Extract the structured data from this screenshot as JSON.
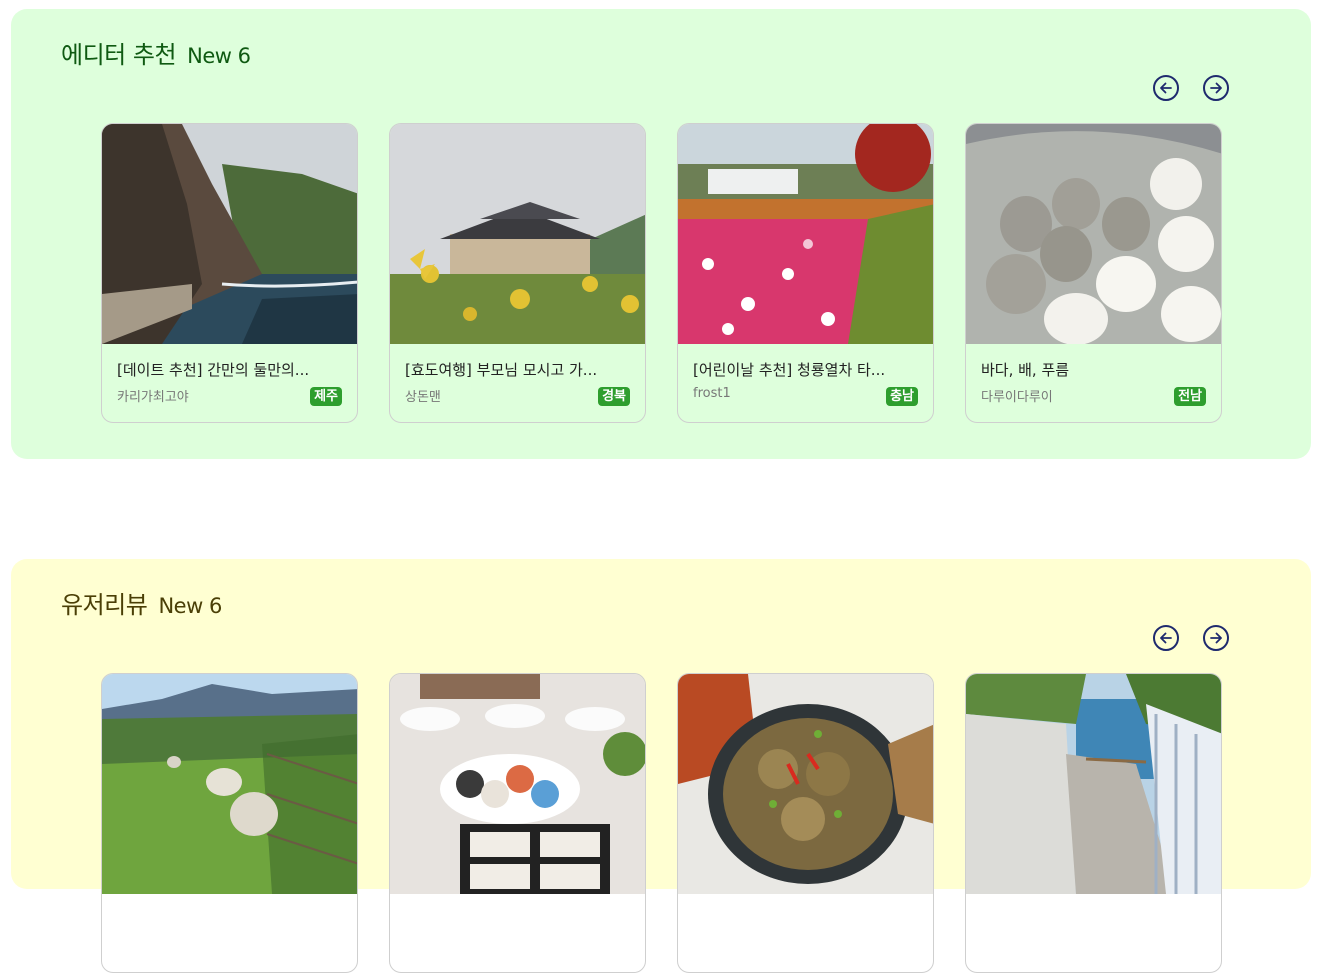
{
  "colors": {
    "editor_bg": "#deffdc",
    "editor_title": "#0f5a12",
    "user_bg": "#ffffd2",
    "user_title": "#4a3f06",
    "arrow": "#1f2a6e",
    "badge": "#2e9e2e"
  },
  "editor_section": {
    "title": "에디터 추천",
    "new_label": "New 6",
    "prev_icon": "arrow-left-circle-icon",
    "next_icon": "arrow-right-circle-icon",
    "cards": [
      {
        "title": "[데이트 추천] 간만의 둘만의...",
        "author": "카리가최고야",
        "region": "제주",
        "image": "coastal-cliff-photo"
      },
      {
        "title": "[효도여행] 부모님 모시고 가...",
        "author": "상돈맨",
        "region": "경북",
        "image": "hanok-sunflower-photo"
      },
      {
        "title": "[어린이날 추천] 청룡열차 타...",
        "author": "frost1",
        "region": "충남",
        "image": "tulip-garden-photo"
      },
      {
        "title": "바다, 배, 푸름",
        "author": "다루이다루이",
        "region": "전남",
        "image": "steamed-buns-photo"
      }
    ]
  },
  "user_section": {
    "title": "유저리뷰",
    "new_label": "New 6",
    "prev_icon": "arrow-left-circle-icon",
    "next_icon": "arrow-right-circle-icon",
    "cards": [
      {
        "image": "sheep-pasture-photo"
      },
      {
        "image": "korean-table-food-photo"
      },
      {
        "image": "crab-dish-photo"
      },
      {
        "image": "seaside-alley-photo"
      }
    ]
  }
}
